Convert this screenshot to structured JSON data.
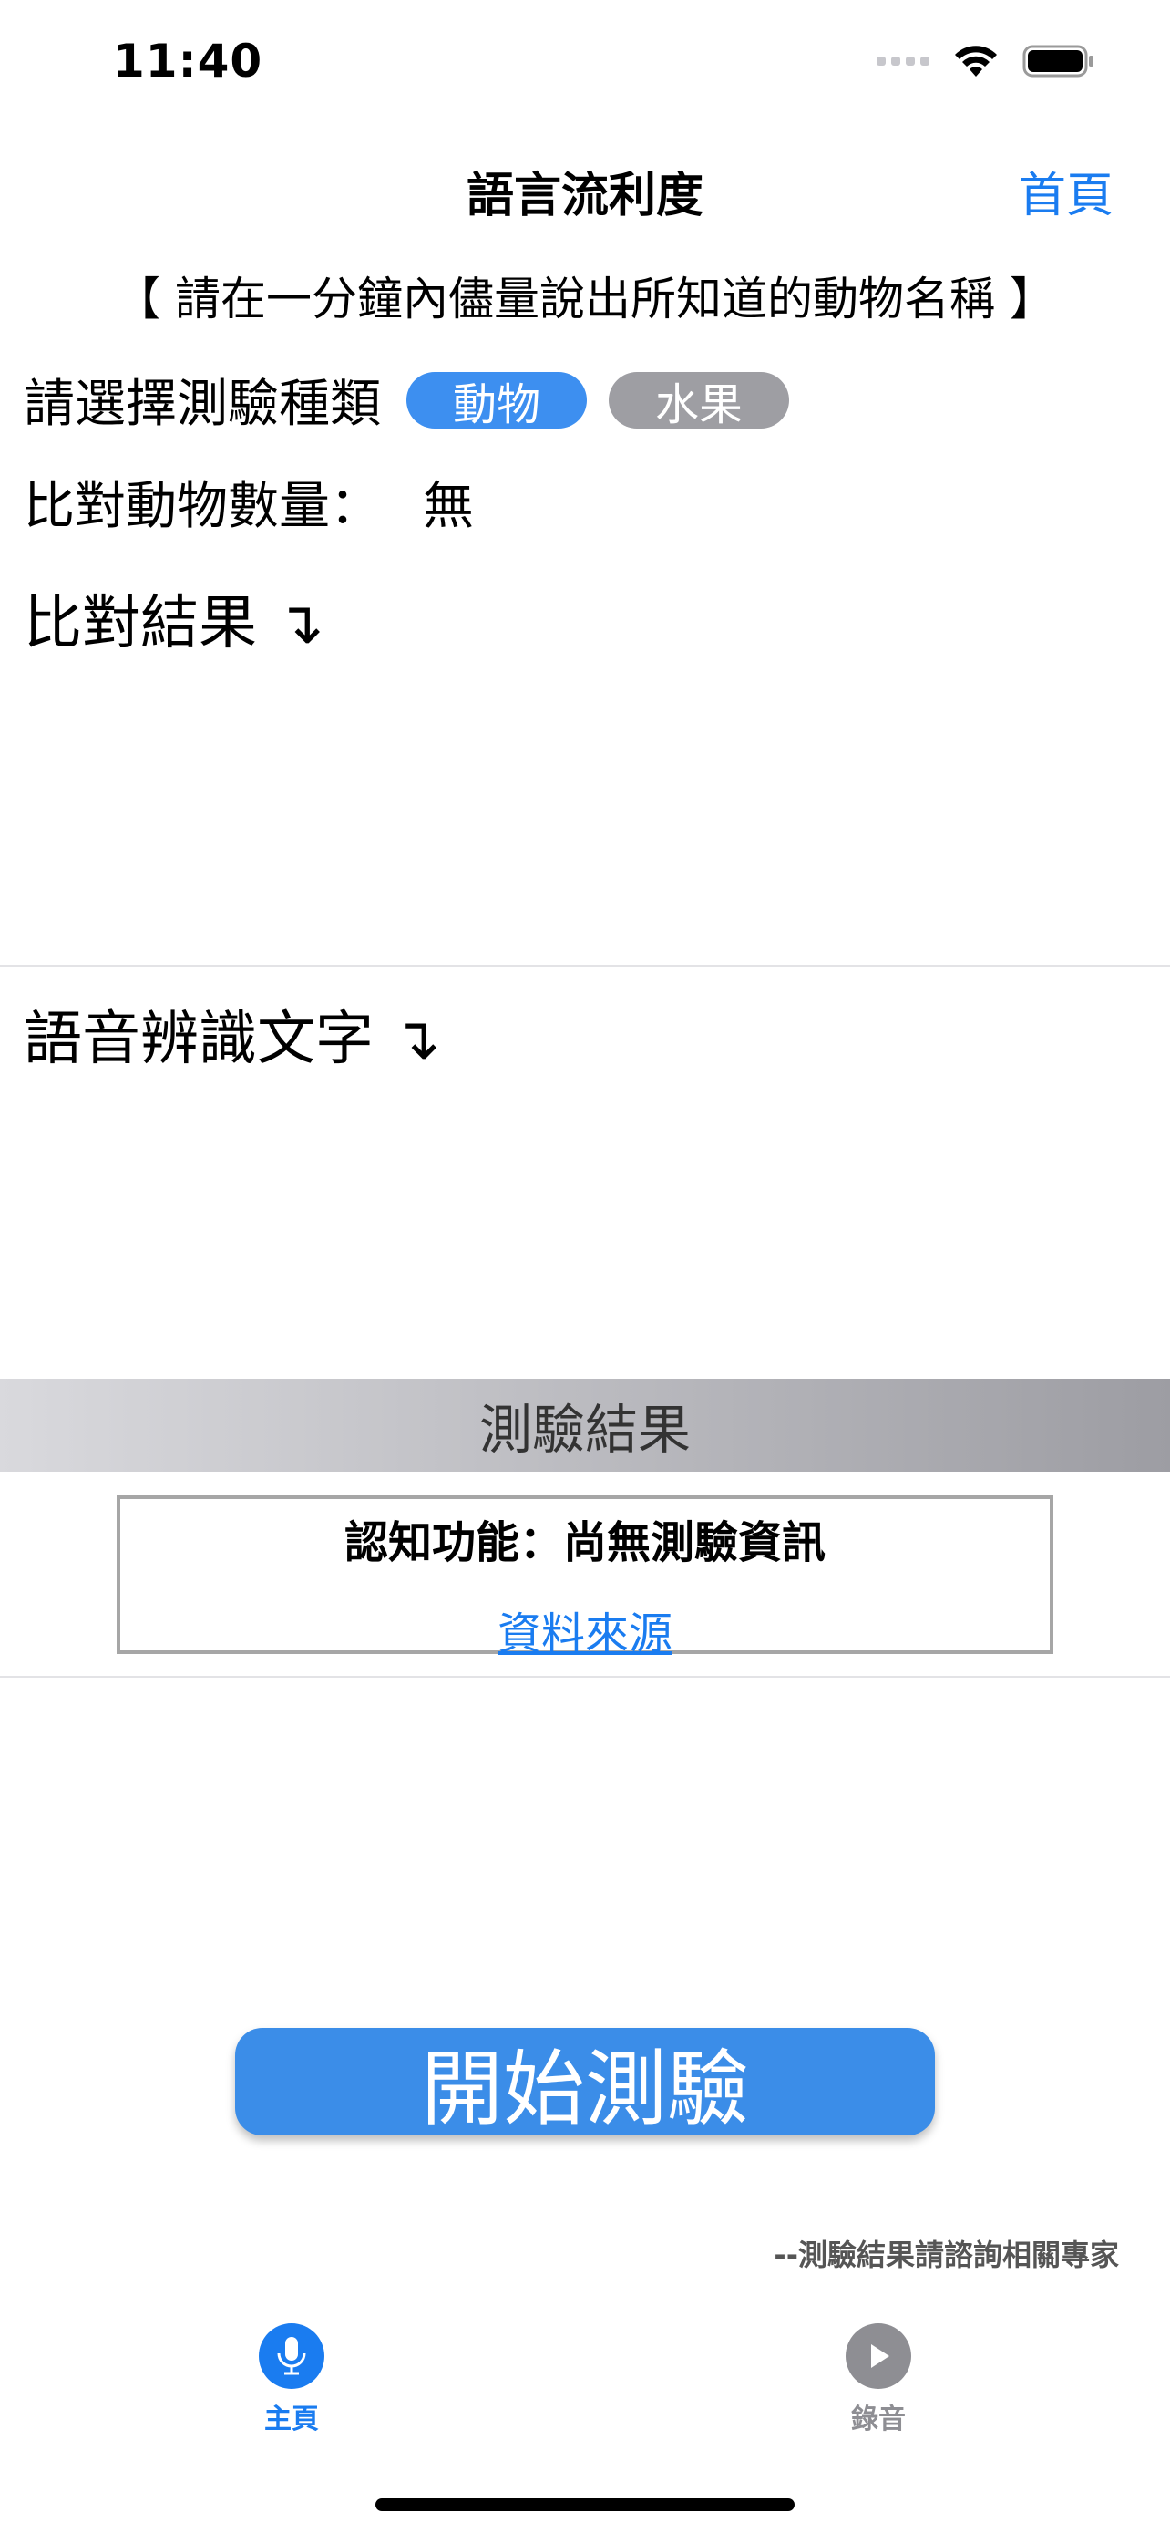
{
  "status_bar": {
    "time": "11:40"
  },
  "nav": {
    "title": "語言流利度",
    "home_label": "首頁"
  },
  "instruction": "【 請在一分鐘內儘量說出所知道的動物名稱 】",
  "test_type": {
    "label": "請選擇測驗種類",
    "options": [
      "動物",
      "水果"
    ],
    "selected": "動物"
  },
  "compare_count": {
    "label": "比對動物數量：",
    "value": "無"
  },
  "sections": {
    "compare_result": "比對結果 ↴",
    "speech_text": "語音辨識文字 ↴"
  },
  "result": {
    "header": "測驗結果",
    "cognitive": "認知功能：尚無測驗資訊",
    "source_link": "資料來源"
  },
  "start_button": "開始測驗",
  "disclaimer": "--測驗結果請諮詢相關專家",
  "tabs": [
    {
      "label": "主頁",
      "icon": "microphone-icon",
      "active": true
    },
    {
      "label": "錄音",
      "icon": "play-icon",
      "active": false
    }
  ],
  "colors": {
    "accent": "#1a7cf0",
    "pill_active": "#3d8ff0",
    "pill_inactive": "#9e9ea3",
    "tab_inactive": "#8e8e93"
  }
}
